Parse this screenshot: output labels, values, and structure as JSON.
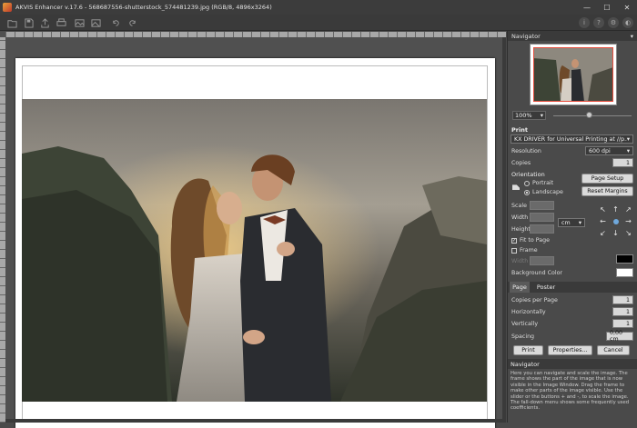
{
  "window": {
    "title": "AKVIS Enhancer v.17.6 - 568687556-shutterstock_574481239.jpg (RGB/8, 4896x3264)",
    "minimize": "—",
    "maximize": "☐",
    "close": "✕"
  },
  "toolbar": {
    "left_icons": [
      "open-icon",
      "save-icon",
      "print-icon",
      "share-icon",
      "batch-icon",
      "settings-icon",
      "undo-icon",
      "redo-icon"
    ],
    "right_icons": [
      "info-icon",
      "help-icon",
      "preferences-icon",
      "account-icon"
    ],
    "info_glyph": "i",
    "help_glyph": "?",
    "prefs_glyph": "⚙",
    "account_glyph": "◐"
  },
  "navigator": {
    "header": "Navigator",
    "collapse_glyph": "▾",
    "zoom_value": "100%",
    "zoom_level": 0.45
  },
  "print": {
    "header": "Print",
    "printer": "KX DRIVER for Universal Printing at //p...",
    "resolution_label": "Resolution",
    "resolution_value": "600 dpi",
    "copies_label": "Copies",
    "copies_value": "1",
    "orientation_label": "Orientation",
    "page_setup": "Page Setup",
    "portrait": "Portrait",
    "landscape": "Landscape",
    "reset_margins": "Reset Margins",
    "scale_label": "Scale",
    "width_label": "Width",
    "height_label": "Height",
    "unit": "cm",
    "fit_to_page": "Fit to Page",
    "frame_label": "Frame",
    "frame_width_label": "Width",
    "frame_color": "#000000",
    "background_color_label": "Background Color",
    "background_color": "#ffffff"
  },
  "tabs": {
    "page": "Page",
    "poster": "Poster"
  },
  "page_settings": {
    "copies_per_page_label": "Copies per Page",
    "copies_per_page_value": "1",
    "horizontally_label": "Horizontally",
    "horizontally_value": "1",
    "vertically_label": "Vertically",
    "vertically_value": "1",
    "spacing_label": "Spacing",
    "spacing_value": "0,00 cm"
  },
  "actions": {
    "print": "Print",
    "properties": "Properties...",
    "cancel": "Cancel"
  },
  "help": {
    "header": "Navigator",
    "text": "Here you can navigate and scale the image. The frame shows the part of the image that is now visible in the Image Window. Drag the frame to make other parts of the image visible. Use the slider or the buttons + and -, to scale the image. The fall-down menu shows some frequently used coefficients."
  }
}
